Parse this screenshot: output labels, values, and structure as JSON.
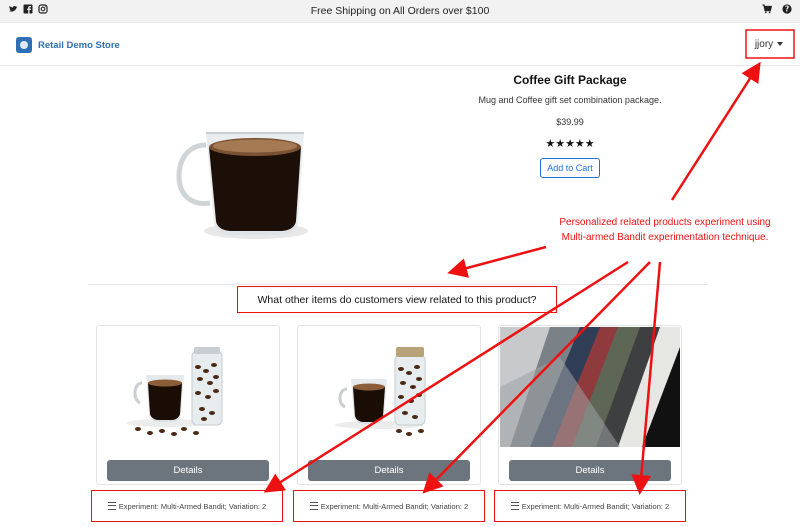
{
  "topbar": {
    "promo": "Free Shipping on All Orders over $100",
    "social_icons": [
      "twitter-icon",
      "facebook-icon",
      "instagram-icon"
    ],
    "right_icons": [
      "cart-icon",
      "help-icon"
    ]
  },
  "navbar": {
    "brand": "Retail Demo Store",
    "user": "jjory"
  },
  "product": {
    "title": "Coffee Gift Package",
    "description": "Mug and Coffee gift set combination package.",
    "price": "$39.99",
    "rating": "★★★★★",
    "add_to_cart": "Add to Cart"
  },
  "related": {
    "heading": "What other items do customers view related to this product?",
    "cards": [
      {
        "button": "Details",
        "experiment": "Experiment: Multi-Armed Bandit; Variation: 2"
      },
      {
        "button": "Details",
        "experiment": "Experiment: Multi-Armed Bandit; Variation: 2"
      },
      {
        "button": "Details",
        "experiment": "Experiment: Multi-Armed Bandit; Variation: 2"
      }
    ]
  },
  "annotation": {
    "line1": "Personalized related products experiment using",
    "line2": "Multi-armed Bandit experimentation technique."
  },
  "colors": {
    "annotation": "#e11111",
    "brand": "#2f6fb5",
    "button": "#6c757d",
    "link": "#1e6fd9"
  }
}
